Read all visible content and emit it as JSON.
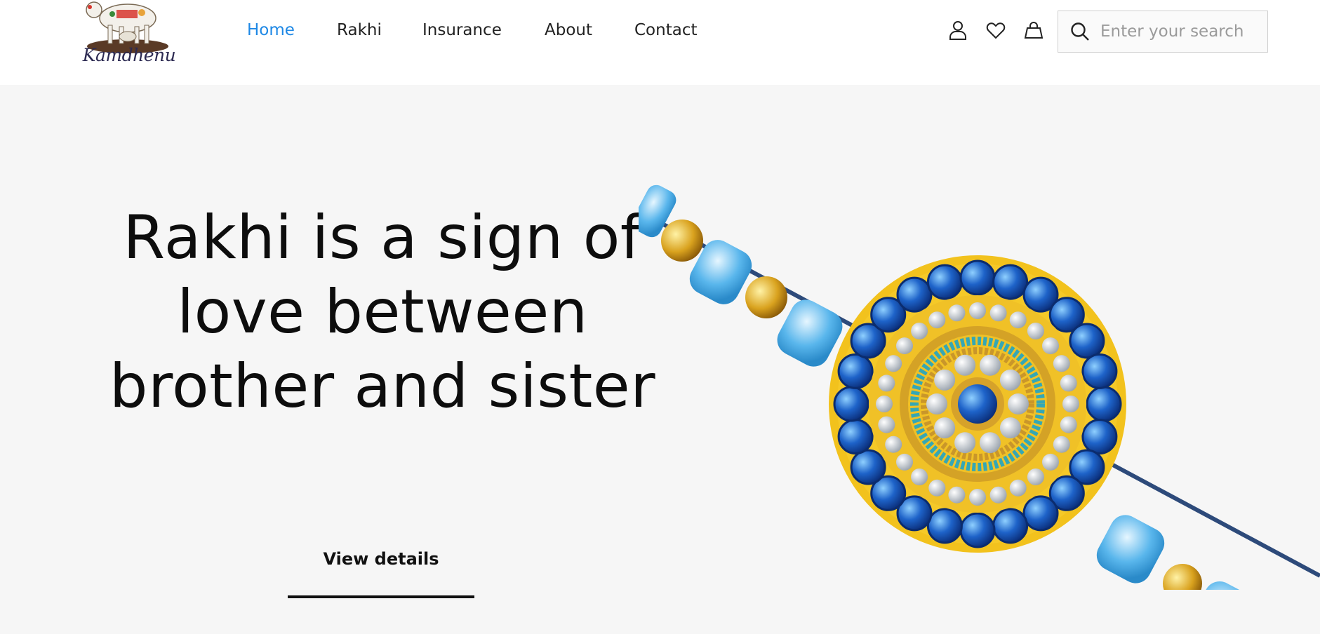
{
  "brand": {
    "logo_text": "Kamdhenu"
  },
  "nav": {
    "items": [
      {
        "label": "Home",
        "active": true
      },
      {
        "label": "Rakhi",
        "active": false
      },
      {
        "label": "Insurance",
        "active": false
      },
      {
        "label": "About",
        "active": false
      },
      {
        "label": "Contact",
        "active": false
      }
    ]
  },
  "header_icons": [
    "user-icon",
    "heart-icon",
    "bag-icon"
  ],
  "search": {
    "placeholder": "Enter your search",
    "value": ""
  },
  "hero": {
    "title": "Rakhi is a sign of love between brother and sister",
    "cta_label": "View details"
  },
  "colors": {
    "accent": "#1e88e5",
    "hero_bg": "#f6f6f6",
    "text": "#111111"
  }
}
